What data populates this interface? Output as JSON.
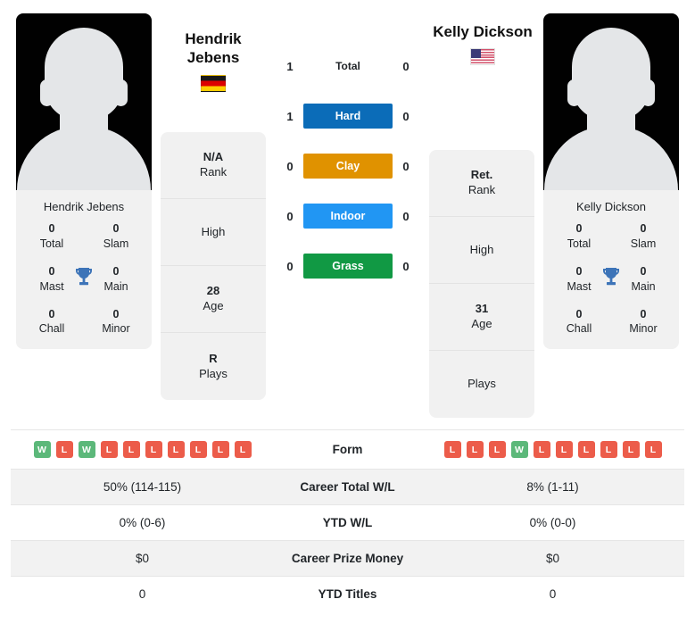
{
  "players": {
    "left": {
      "name": "Hendrik Jebens",
      "name_line1": "Hendrik",
      "name_line2": "Jebens",
      "flag": "flag-germany-icon",
      "card_name": "Hendrik Jebens",
      "titles": [
        [
          {
            "value": "0",
            "label": "Total"
          },
          {
            "value": "0",
            "label": "Slam"
          }
        ],
        [
          {
            "value": "0",
            "label": "Mast"
          },
          {
            "value": "0",
            "label": "Main"
          }
        ],
        [
          {
            "value": "0",
            "label": "Chall"
          },
          {
            "value": "0",
            "label": "Minor"
          }
        ]
      ],
      "info": [
        {
          "value": "N/A",
          "label": "Rank"
        },
        {
          "value": "",
          "label": "High"
        },
        {
          "value": "28",
          "label": "Age"
        },
        {
          "value": "R",
          "label": "Plays"
        }
      ],
      "surface_counts": [
        "1",
        "1",
        "0",
        "0",
        "0"
      ],
      "form": [
        "W",
        "L",
        "W",
        "L",
        "L",
        "L",
        "L",
        "L",
        "L",
        "L"
      ],
      "career_total_wl": "50% (114-115)",
      "ytd_wl": "0% (0-6)",
      "career_prize_money": "$0",
      "ytd_titles": "0"
    },
    "right": {
      "name": "Kelly Dickson",
      "name_line1": "Kelly Dickson",
      "name_line2": "",
      "flag": "flag-usa-icon",
      "card_name": "Kelly Dickson",
      "titles": [
        [
          {
            "value": "0",
            "label": "Total"
          },
          {
            "value": "0",
            "label": "Slam"
          }
        ],
        [
          {
            "value": "0",
            "label": "Mast"
          },
          {
            "value": "0",
            "label": "Main"
          }
        ],
        [
          {
            "value": "0",
            "label": "Chall"
          },
          {
            "value": "0",
            "label": "Minor"
          }
        ]
      ],
      "info": [
        {
          "value": "Ret.",
          "label": "Rank"
        },
        {
          "value": "",
          "label": "High"
        },
        {
          "value": "31",
          "label": "Age"
        },
        {
          "value": "",
          "label": "Plays"
        }
      ],
      "surface_counts": [
        "0",
        "0",
        "0",
        "0",
        "0"
      ],
      "form": [
        "L",
        "L",
        "L",
        "W",
        "L",
        "L",
        "L",
        "L",
        "L",
        "L"
      ],
      "career_total_wl": "8% (1-11)",
      "ytd_wl": "0% (0-0)",
      "career_prize_money": "$0",
      "ytd_titles": "0"
    }
  },
  "surfaces": [
    {
      "label": "Total",
      "badge": false,
      "color": ""
    },
    {
      "label": "Hard",
      "badge": true,
      "color": "#0b6cb8"
    },
    {
      "label": "Clay",
      "badge": true,
      "color": "#e09200"
    },
    {
      "label": "Indoor",
      "badge": true,
      "color": "#2196f3"
    },
    {
      "label": "Grass",
      "badge": true,
      "color": "#119944"
    }
  ],
  "stats_rows": [
    {
      "label": "Form"
    },
    {
      "label": "Career Total W/L"
    },
    {
      "label": "YTD W/L"
    },
    {
      "label": "Career Prize Money"
    },
    {
      "label": "YTD Titles"
    }
  ],
  "colors": {
    "win_badge": "#5cb87a",
    "loss_badge": "#ec5c4a",
    "trophy": "#3d74b8",
    "card_bg": "#f1f1f1",
    "row_alt_bg": "#f2f2f2"
  },
  "icons": {
    "trophy": "trophy-icon"
  }
}
